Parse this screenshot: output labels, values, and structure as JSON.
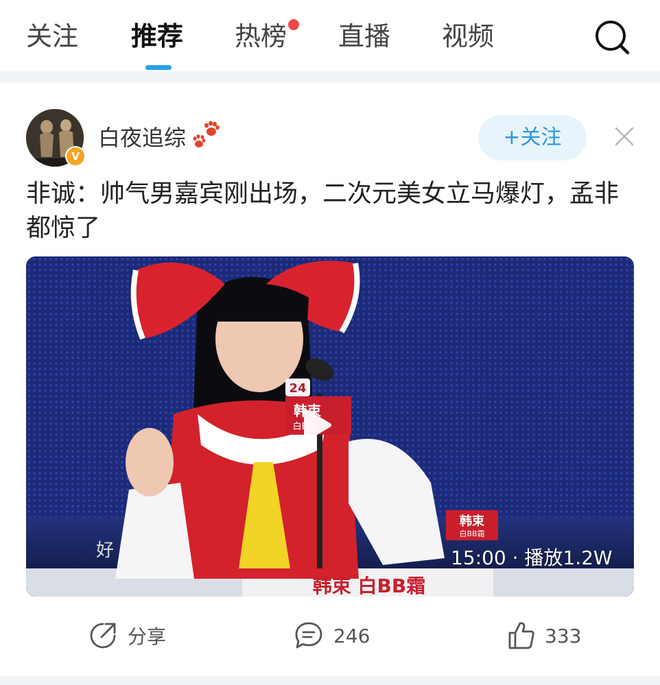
{
  "nav": {
    "tabs": [
      {
        "label": "关注"
      },
      {
        "label": "推荐"
      },
      {
        "label": "热榜"
      },
      {
        "label": "直播"
      },
      {
        "label": "视频"
      }
    ],
    "active_tab": "推荐",
    "icons": {
      "search": "search-icon"
    },
    "accent_color": "#2aa0e6",
    "badge_color": "#f04848"
  },
  "post": {
    "author": {
      "name": "白夜追综",
      "verified_badge": "V"
    },
    "follow_label": "+关注",
    "title": "非诚：帅气男嘉宾刚出场，二次元美女立马爆灯，孟非都惊了",
    "video": {
      "meta": "15:00 · 播放1.2W",
      "podium_text": "韩束 白BB霜",
      "mic_number": "24",
      "mic_brand": "韩束",
      "mic_sub": "白BB",
      "caption_fragment": "好",
      "sign_brand": "韩束",
      "sign_sub": "白BB霜"
    },
    "actions": {
      "share_label": "分享",
      "comment_count": "246",
      "like_count": "333"
    }
  }
}
